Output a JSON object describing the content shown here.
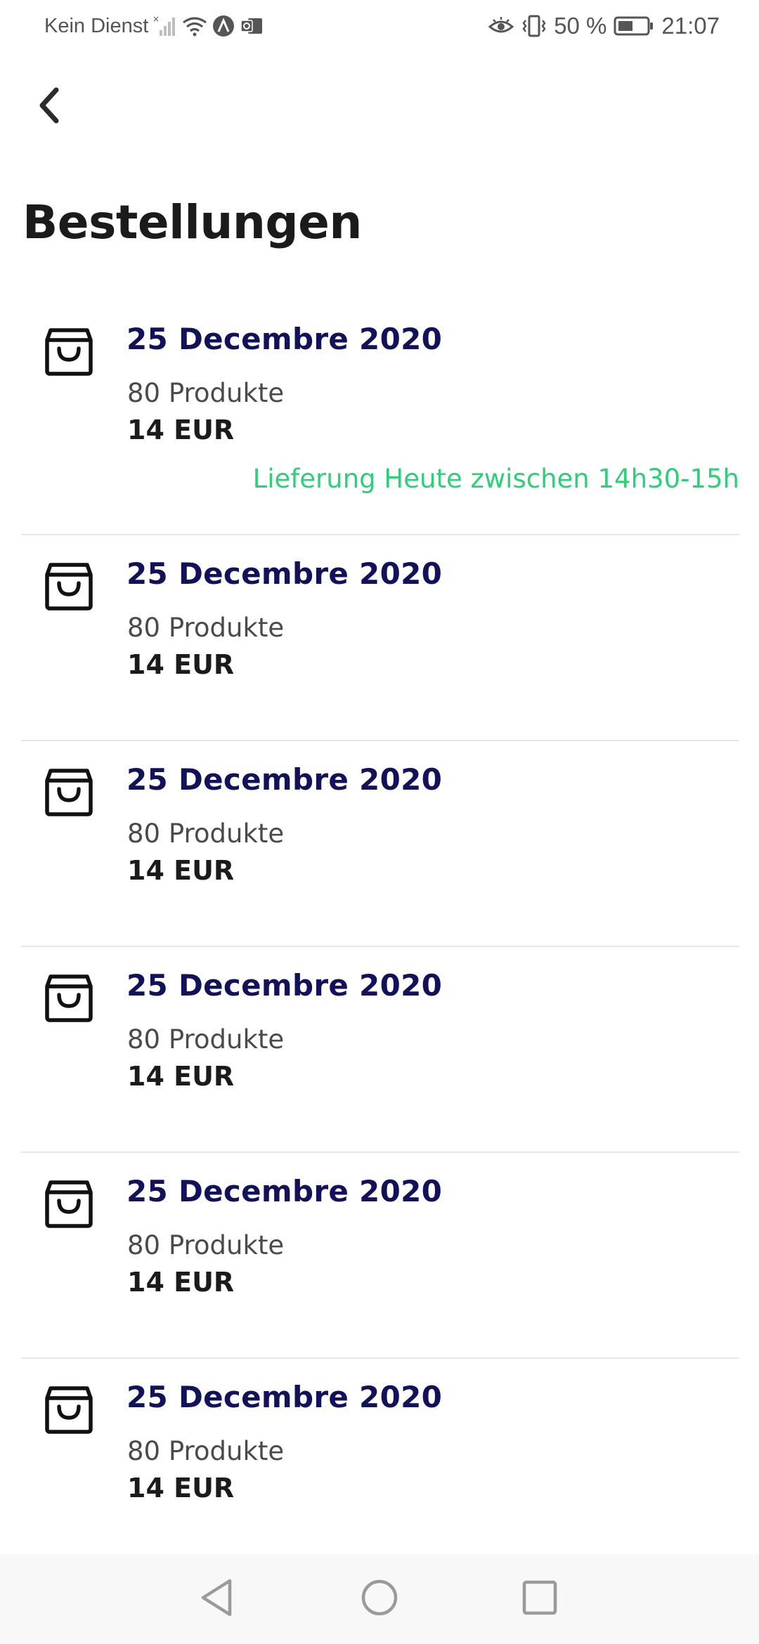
{
  "status_bar": {
    "carrier": "Kein Dienst",
    "battery_percent": "50 %",
    "time": "21:07",
    "icons": [
      "no-signal-icon",
      "wifi-icon",
      "app-notification-icon",
      "outlook-icon",
      "eye-comfort-icon",
      "vibrate-icon",
      "battery-icon"
    ]
  },
  "header": {
    "back_icon": "chevron-left-icon",
    "title": "Bestellungen"
  },
  "orders": [
    {
      "date": "25 Decembre 2020",
      "products": "80 Produkte",
      "price": "14 EUR",
      "delivery": "Lieferung Heute zwischen 14h30-15h",
      "icon": "shopping-bag-icon"
    },
    {
      "date": "25 Decembre 2020",
      "products": "80 Produkte",
      "price": "14 EUR",
      "icon": "shopping-bag-icon"
    },
    {
      "date": "25 Decembre 2020",
      "products": "80 Produkte",
      "price": "14 EUR",
      "icon": "shopping-bag-icon"
    },
    {
      "date": "25 Decembre 2020",
      "products": "80 Produkte",
      "price": "14 EUR",
      "icon": "shopping-bag-icon"
    },
    {
      "date": "25 Decembre 2020",
      "products": "80 Produkte",
      "price": "14 EUR",
      "icon": "shopping-bag-icon"
    },
    {
      "date": "25 Decembre 2020",
      "products": "80 Produkte",
      "price": "14 EUR",
      "icon": "shopping-bag-icon"
    }
  ],
  "nav_bar": {
    "buttons": [
      "nav-back-icon",
      "nav-home-icon",
      "nav-recents-icon"
    ]
  },
  "colors": {
    "date": "#11125a",
    "delivery": "#2ecf79",
    "title": "#1b1b1b",
    "divider": "#e6e6e6",
    "nav_background": "#f8f8f8"
  }
}
